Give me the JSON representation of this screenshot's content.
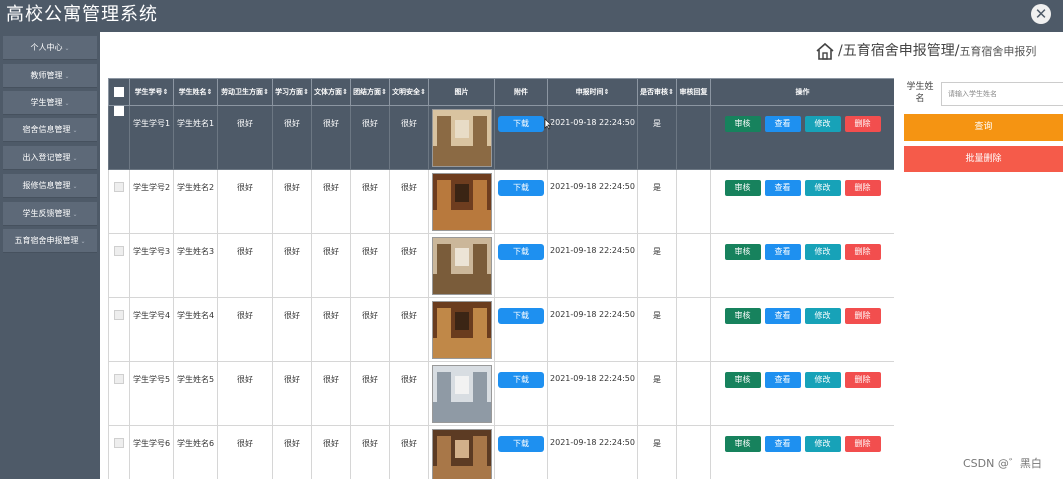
{
  "app": {
    "title": "高校公寓管理系统",
    "close_icon": "close-circle-icon"
  },
  "sidebar": {
    "items": [
      {
        "label": "个人中心"
      },
      {
        "label": "教师管理"
      },
      {
        "label": "学生管理"
      },
      {
        "label": "宿舍信息管理"
      },
      {
        "label": "出入登记管理"
      },
      {
        "label": "报修信息管理"
      },
      {
        "label": "学生反馈管理"
      },
      {
        "label": "五育宿舍申报管理"
      }
    ]
  },
  "breadcrumb": {
    "main": "五育宿舍申报管理",
    "sep": "/",
    "sub": "五育宿舍申报列"
  },
  "table": {
    "headers": [
      "学生学号",
      "学生姓名",
      "劳动卫生方面",
      "学习方面",
      "文体方面",
      "团结方面",
      "文明安全",
      "图片",
      "附件",
      "申报时间",
      "是否审核",
      "审核回复",
      "操作"
    ],
    "sort_icon": "sort-arrows-icon",
    "rows": [
      {
        "id": "学生学号1",
        "name": "学生姓名1",
        "labor": "很好",
        "study": "很好",
        "sports": "很好",
        "unity": "很好",
        "safety": "很好",
        "download": "下载",
        "time": "2021-09-18 22:24:50",
        "audited": "是",
        "reply": "",
        "selected": true
      },
      {
        "id": "学生学号2",
        "name": "学生姓名2",
        "labor": "很好",
        "study": "很好",
        "sports": "很好",
        "unity": "很好",
        "safety": "很好",
        "download": "下载",
        "time": "2021-09-18 22:24:50",
        "audited": "是",
        "reply": "",
        "selected": false
      },
      {
        "id": "学生学号3",
        "name": "学生姓名3",
        "labor": "很好",
        "study": "很好",
        "sports": "很好",
        "unity": "很好",
        "safety": "很好",
        "download": "下载",
        "time": "2021-09-18 22:24:50",
        "audited": "是",
        "reply": "",
        "selected": false
      },
      {
        "id": "学生学号4",
        "name": "学生姓名4",
        "labor": "很好",
        "study": "很好",
        "sports": "很好",
        "unity": "很好",
        "safety": "很好",
        "download": "下载",
        "time": "2021-09-18 22:24:50",
        "audited": "是",
        "reply": "",
        "selected": false
      },
      {
        "id": "学生学号5",
        "name": "学生姓名5",
        "labor": "很好",
        "study": "很好",
        "sports": "很好",
        "unity": "很好",
        "safety": "很好",
        "download": "下载",
        "time": "2021-09-18 22:24:50",
        "audited": "是",
        "reply": "",
        "selected": false
      },
      {
        "id": "学生学号6",
        "name": "学生姓名6",
        "labor": "很好",
        "study": "很好",
        "sports": "很好",
        "unity": "很好",
        "safety": "很好",
        "download": "下载",
        "time": "2021-09-18 22:24:50",
        "audited": "是",
        "reply": "",
        "selected": false
      }
    ],
    "actions": {
      "audit": "审核",
      "view": "查看",
      "edit": "修改",
      "delete": "删除"
    }
  },
  "search": {
    "label": "学生姓名",
    "placeholder": "请输入学生姓名",
    "query": "查询",
    "bulk_delete": "批量删除"
  },
  "watermark": "CSDN @゛黑白",
  "colors": {
    "header": "#4e5a68",
    "download": "#1e90f0",
    "audit": "#17825d",
    "view": "#1e90f0",
    "edit": "#17a2b8",
    "delete": "#f24e4e",
    "query": "#f59412",
    "bulk_delete": "#f55b4a"
  }
}
